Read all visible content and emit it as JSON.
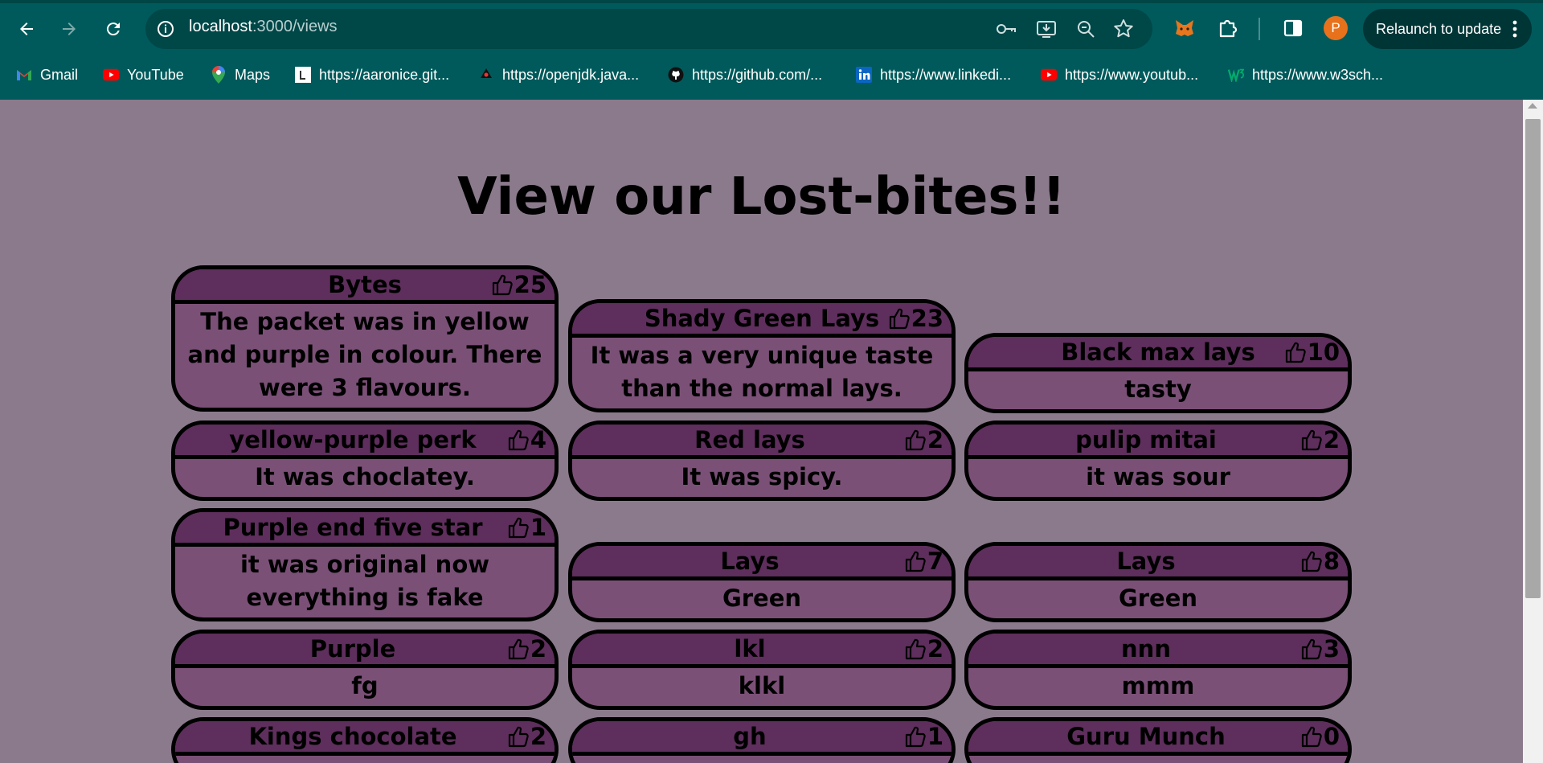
{
  "browser": {
    "url_host": "localhost",
    "url_path": ":3000/views",
    "relaunch_label": "Relaunch to update",
    "profile_initial": "P",
    "bookmarks": [
      {
        "label": "Gmail",
        "icon": "gmail-icon"
      },
      {
        "label": "YouTube",
        "icon": "youtube-icon"
      },
      {
        "label": "Maps",
        "icon": "maps-icon"
      },
      {
        "label": "https://aaronice.git...",
        "icon": "l-icon"
      },
      {
        "label": "https://openjdk.java...",
        "icon": "duke-icon"
      },
      {
        "label": "https://github.com/...",
        "icon": "github-icon"
      },
      {
        "label": "https://www.linkedi...",
        "icon": "linkedin-icon"
      },
      {
        "label": "https://www.youtub...",
        "icon": "youtube-icon"
      },
      {
        "label": "https://www.w3sch...",
        "icon": "w3schools-icon"
      }
    ]
  },
  "page": {
    "heading": "View our Lost-bites!!",
    "colors": {
      "background": "#8b7a8c",
      "card_head": "#5e2e5c",
      "card_body": "#7b5077"
    },
    "cards": [
      {
        "title": "Bytes",
        "likes": "25",
        "description": "The packet was in yellow and purple in colour. There were 3 flavours."
      },
      {
        "title": "Shady Green Lays",
        "likes": "23",
        "description": "It was a very unique taste than the normal lays."
      },
      {
        "title": "Black max lays",
        "likes": "10",
        "description": "tasty"
      },
      {
        "title": "yellow-purple perk",
        "likes": "4",
        "description": "It was choclatey."
      },
      {
        "title": "Red lays",
        "likes": "2",
        "description": "It was spicy."
      },
      {
        "title": "pulip mitai",
        "likes": "2",
        "description": "it was sour"
      },
      {
        "title": "Purple end five star",
        "likes": "1",
        "description": "it was original now everything is fake"
      },
      {
        "title": "Lays",
        "likes": "7",
        "description": "Green"
      },
      {
        "title": "Lays",
        "likes": "8",
        "description": "Green"
      },
      {
        "title": "Purple",
        "likes": "2",
        "description": "fg"
      },
      {
        "title": "lkl",
        "likes": "2",
        "description": "klkl"
      },
      {
        "title": "nnn",
        "likes": "3",
        "description": "mmm"
      },
      {
        "title": "Kings chocolate",
        "likes": "2",
        "description": ""
      },
      {
        "title": "gh",
        "likes": "1",
        "description": ""
      },
      {
        "title": "Guru Munch",
        "likes": "0",
        "description": ""
      }
    ]
  }
}
